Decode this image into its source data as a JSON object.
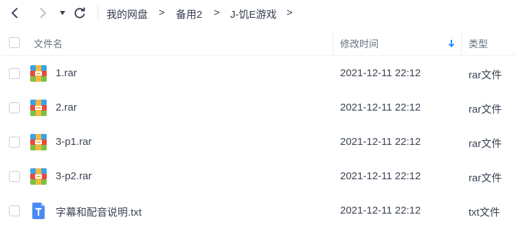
{
  "toolbar": {
    "back_icon": "chevron-left-icon",
    "forward_icon": "chevron-right-icon",
    "history_icon": "caret-down-icon",
    "refresh_icon": "refresh-icon"
  },
  "breadcrumb": {
    "items": [
      "我的网盘",
      "备用2",
      "J-饥E游戏"
    ],
    "separator": ">"
  },
  "table": {
    "headers": {
      "name": "文件名",
      "modified": "修改时间",
      "type": "类型"
    },
    "sort_icon": "arrow-down-icon",
    "sort_color": "#1e90ff",
    "rows": [
      {
        "name": "1.rar",
        "modified": "2021-12-11 22:12",
        "type": "rar文件",
        "icon": "rar-archive-icon"
      },
      {
        "name": "2.rar",
        "modified": "2021-12-11 22:12",
        "type": "rar文件",
        "icon": "rar-archive-icon"
      },
      {
        "name": "3-p1.rar",
        "modified": "2021-12-11 22:12",
        "type": "rar文件",
        "icon": "rar-archive-icon"
      },
      {
        "name": "3-p2.rar",
        "modified": "2021-12-11 22:12",
        "type": "rar文件",
        "icon": "rar-archive-icon"
      },
      {
        "name": "字幕和配音说明.txt",
        "modified": "2021-12-11 22:12",
        "type": "txt文件",
        "icon": "text-file-icon"
      }
    ]
  }
}
